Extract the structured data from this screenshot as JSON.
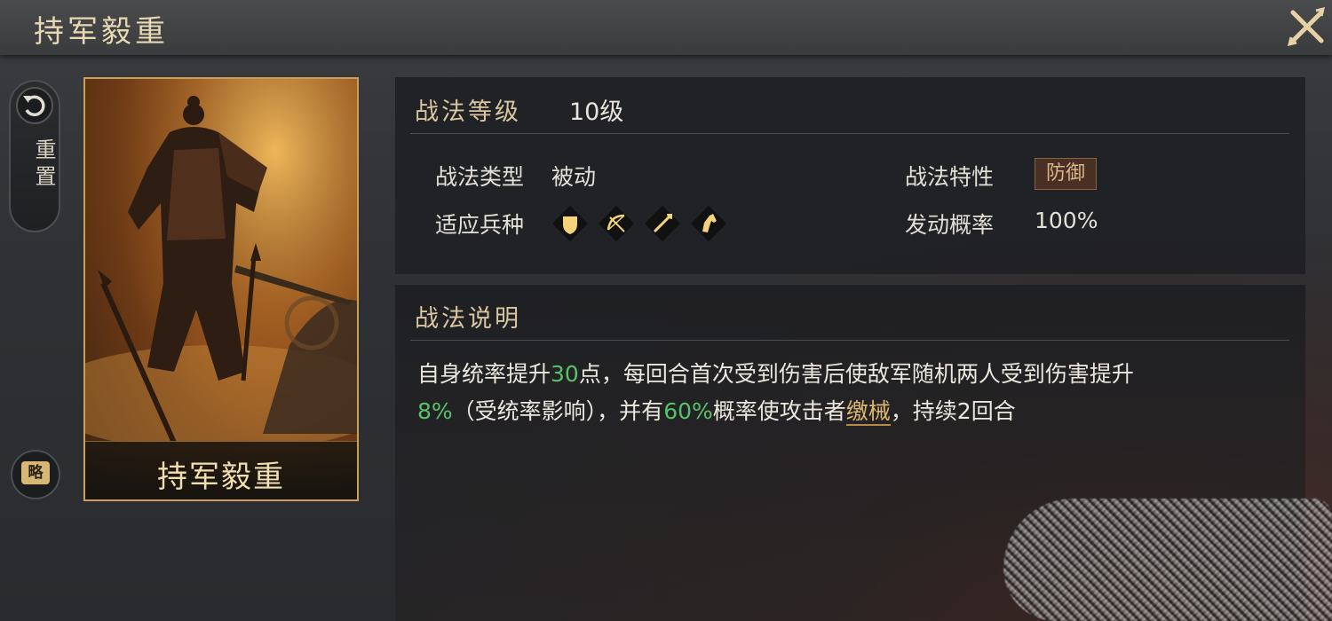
{
  "title": "持军毅重",
  "sidebar": {
    "reset_label": "重置",
    "strategy_label": "略"
  },
  "card": {
    "name": "持军毅重"
  },
  "info": {
    "level_label": "战法等级",
    "level_value": "10级",
    "type_label": "战法类型",
    "type_value": "被动",
    "trait_label": "战法特性",
    "trait_value": "防御",
    "troops_label": "适应兵种",
    "troops": [
      "shield-troop-icon",
      "bow-troop-icon",
      "spear-troop-icon",
      "horse-troop-icon"
    ],
    "rate_label": "发动概率",
    "rate_value": "100%"
  },
  "description": {
    "heading": "战法说明",
    "part1": "自身统率提升",
    "num1": "30",
    "part2": "点，每回合首次受到伤害后使敌军随机两人受到伤害提升",
    "num2": "8%",
    "part3": "（受统率影响），并有",
    "num3": "60%",
    "part4": "概率使攻击者",
    "keyword": "缴械",
    "part5": "，持续2回合"
  },
  "colors": {
    "accent_gold": "#d8c7a0",
    "highlight_green": "#57c26a",
    "keyword_gold": "#dcb86e",
    "trait_badge_bg": "#4a2f24"
  }
}
